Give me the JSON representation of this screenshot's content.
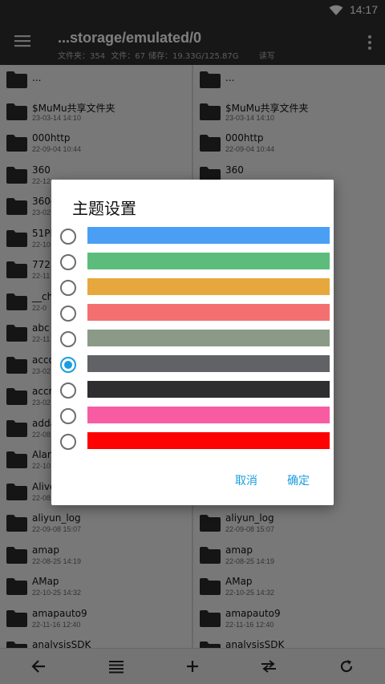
{
  "status": {
    "time": "14:17"
  },
  "toolbar": {
    "path": "...storage/emulated/0",
    "folders": "文件夹：354",
    "files": "文件：67",
    "storage": "储存：19.33G/125.87G",
    "mode": "读写"
  },
  "left_pane": [
    {
      "name": "...",
      "date": ""
    },
    {
      "name": "$MuMu共享文件夹",
      "date": "23-03-14 14:10"
    },
    {
      "name": "000http",
      "date": "22-09-04 10:44"
    },
    {
      "name": "360",
      "date": "22-12"
    },
    {
      "name": "360g",
      "date": "23-02"
    },
    {
      "name": "51PK",
      "date": "22-10"
    },
    {
      "name": "7723",
      "date": "22-11"
    },
    {
      "name": "__ch",
      "date": "22-0"
    },
    {
      "name": "abc",
      "date": "22-11"
    },
    {
      "name": "acco",
      "date": "23-02"
    },
    {
      "name": "accm",
      "date": "23-02"
    },
    {
      "name": "adda",
      "date": "22-08"
    },
    {
      "name": "Alar",
      "date": "22-10"
    },
    {
      "name": "Alivc",
      "date": "22-08"
    },
    {
      "name": "aliyun_log",
      "date": "22-09-08 15:07"
    },
    {
      "name": "amap",
      "date": "22-08-25 14:19"
    },
    {
      "name": "AMap",
      "date": "22-10-25 14:32"
    },
    {
      "name": "amapauto9",
      "date": "22-11-16 12:40"
    },
    {
      "name": "analysisSDK",
      "date": ""
    }
  ],
  "right_pane": [
    {
      "name": "...",
      "date": ""
    },
    {
      "name": "$MuMu共享文件夹",
      "date": "23-03-14 14:10"
    },
    {
      "name": "000http",
      "date": "22-09-04 10:44"
    },
    {
      "name": "360",
      "date": ""
    },
    {
      "name": "",
      "date": ""
    },
    {
      "name": "",
      "date": ""
    },
    {
      "name": "",
      "date": ""
    },
    {
      "name": "",
      "date": ""
    },
    {
      "name": "",
      "date": ""
    },
    {
      "name": "",
      "date": ""
    },
    {
      "name": "",
      "date": ""
    },
    {
      "name": "",
      "date": ""
    },
    {
      "name": "",
      "date": ""
    },
    {
      "name": "",
      "date": ""
    },
    {
      "name": "aliyun_log",
      "date": "22-09-08 15:07"
    },
    {
      "name": "amap",
      "date": "22-08-25 14:19"
    },
    {
      "name": "AMap",
      "date": "22-10-25 14:32"
    },
    {
      "name": "amapauto9",
      "date": "22-11-16 12:40"
    },
    {
      "name": "analysisSDK",
      "date": ""
    }
  ],
  "dialog": {
    "title": "主题设置",
    "options": [
      {
        "color": "#4a9ff5",
        "checked": false
      },
      {
        "color": "#5cbc7c",
        "checked": false
      },
      {
        "color": "#e6a83d",
        "checked": false
      },
      {
        "color": "#f47070",
        "checked": false
      },
      {
        "color": "#8a9a86",
        "checked": false
      },
      {
        "color": "#616266",
        "checked": true
      },
      {
        "color": "#2e2e30",
        "checked": false
      },
      {
        "color": "#f75ca3",
        "checked": false
      },
      {
        "color": "#fc0202",
        "checked": false
      }
    ],
    "cancel_label": "取消",
    "ok_label": "确定"
  },
  "bottom_icons": [
    "back-arrow-icon",
    "list-icon",
    "add-icon",
    "swap-icon",
    "refresh-icon"
  ],
  "colors": {
    "bar": "#2e2e30",
    "accent": "#1a9de0",
    "folder": "#2b2b2b"
  }
}
